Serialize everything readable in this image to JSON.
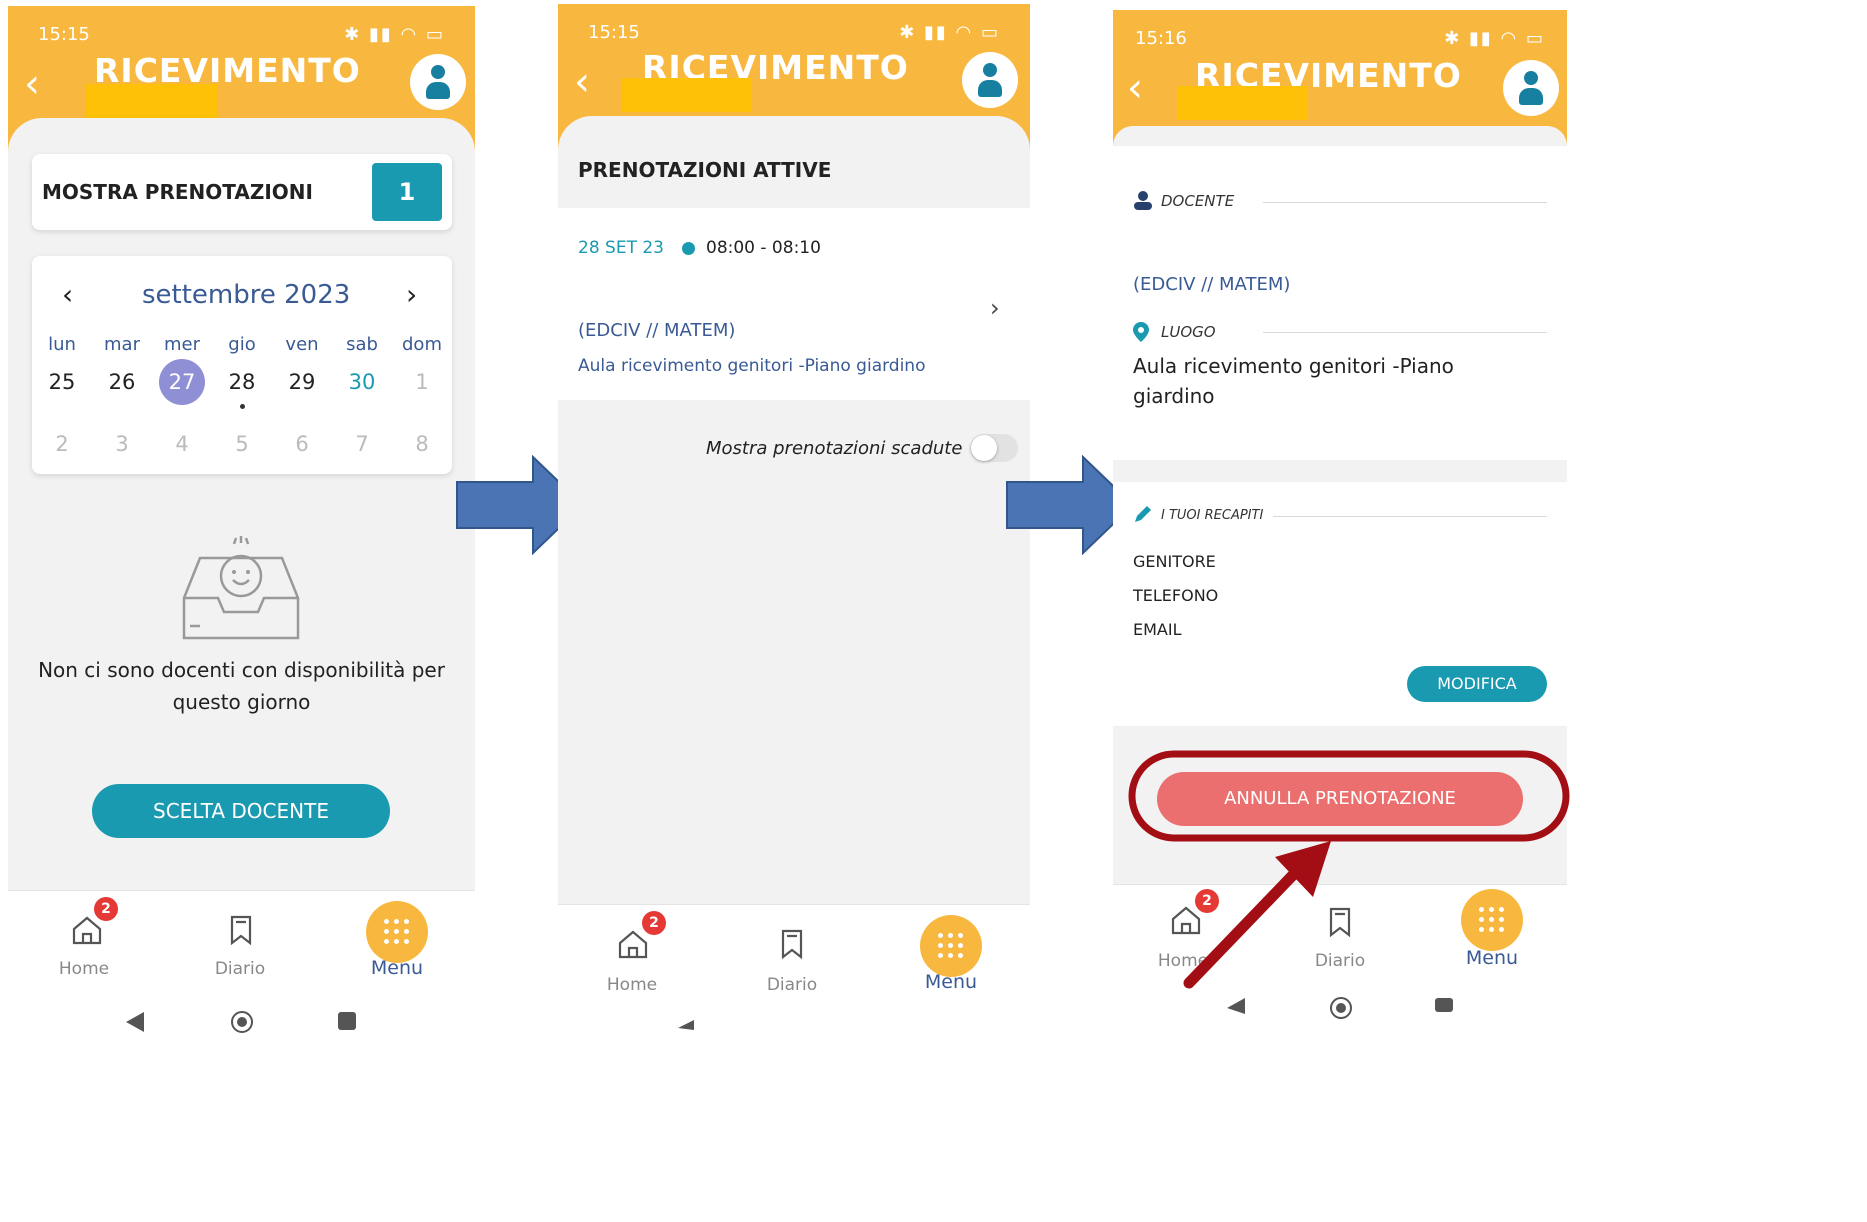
{
  "common": {
    "app_title": "RICEVIMENTO",
    "nav": {
      "home": "Home",
      "diario": "Diario",
      "menu": "Menu",
      "home_badge": "2"
    }
  },
  "panel1": {
    "status_time": "15:15",
    "show_bookings_label": "MOSTRA PRENOTAZIONI",
    "bookings_count": "1",
    "calendar": {
      "month": "settembre 2023",
      "prev": "‹",
      "next": "›",
      "weekdays": [
        "lun",
        "mar",
        "mer",
        "gio",
        "ven",
        "sab",
        "dom"
      ],
      "week1": [
        "25",
        "26",
        "27",
        "28",
        "29",
        "30",
        "1"
      ],
      "week2": [
        "2",
        "3",
        "4",
        "5",
        "6",
        "7",
        "8"
      ],
      "selected_day": "27",
      "marked_day": "28",
      "highlight_day": "30"
    },
    "empty_message_line1": "Non ci sono docenti con disponibilità per",
    "empty_message_line2": "questo giorno",
    "choose_teacher_button": "SCELTA DOCENTE"
  },
  "panel2": {
    "status_time": "15:15",
    "section_title": "PRENOTAZIONI ATTIVE",
    "booking": {
      "date": "28 SET 23",
      "time": "08:00 - 08:10",
      "teacher": "(EDCIV // MATEM)",
      "place": "Aula ricevimento genitori -Piano giardino"
    },
    "expired_toggle_label": "Mostra prenotazioni scadute",
    "expired_toggle_on": false
  },
  "panel3": {
    "status_time": "15:16",
    "docente_label": "DOCENTE",
    "teacher": "(EDCIV // MATEM)",
    "luogo_label": "LUOGO",
    "place_line1": "Aula ricevimento genitori -Piano",
    "place_line2": "giardino",
    "contacts_label": "I TUOI RECAPITI",
    "contacts": [
      "GENITORE",
      "TELEFONO",
      "EMAIL"
    ],
    "edit_button": "MODIFICA",
    "cancel_button": "ANNULLA PRENOTAZIONE"
  },
  "colors": {
    "header_orange": "#f8b840",
    "teal": "#1a9ab0",
    "cancel_red": "#ec6f6f",
    "annotation_dark_red": "#a30d14",
    "arrow_blue": "#4a74b4",
    "selected_day_purple": "#8f8fd6"
  }
}
